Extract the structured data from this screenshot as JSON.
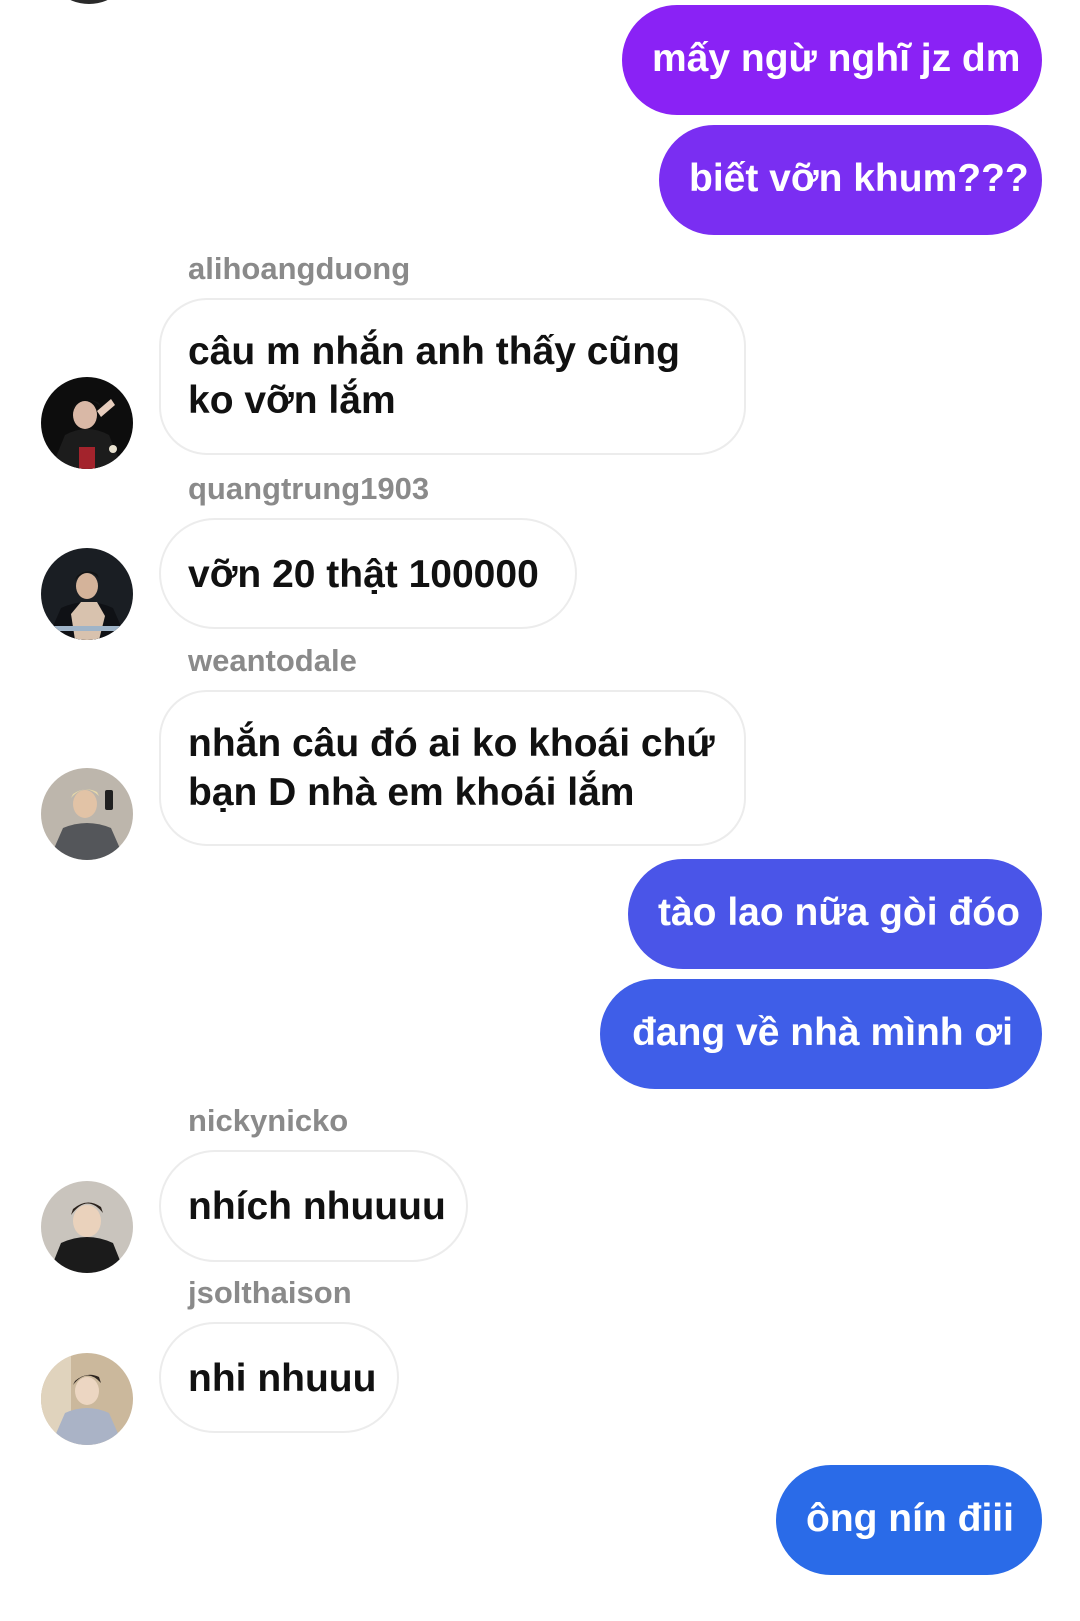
{
  "chat": {
    "colors": {
      "outgoing_purple": "#8a22f5",
      "outgoing_violet": "#7a2ef2",
      "outgoing_indigo": "#4a55e8",
      "outgoing_blue": "#2a6be8",
      "incoming_bg": "#ffffff",
      "sender_name": "#8a8a8a"
    },
    "messages": [
      {
        "direction": "outgoing",
        "text": "mấy ngừ nghĩ jz dm"
      },
      {
        "direction": "outgoing",
        "text": "biết vỡn khum???"
      },
      {
        "direction": "incoming",
        "sender": "alihoangduong",
        "avatar": "alihoangduong-avatar",
        "lines": [
          "câu m nhắn anh thấy cũng",
          "ko vỡn lắm"
        ]
      },
      {
        "direction": "incoming",
        "sender": "quangtrung1903",
        "avatar": "quangtrung1903-avatar",
        "lines": [
          "vỡn 20 thật 100000"
        ]
      },
      {
        "direction": "incoming",
        "sender": "weantodale",
        "avatar": "weantodale-avatar",
        "lines": [
          "nhắn câu đó ai ko khoái chứ",
          "bạn D nhà em khoái lắm"
        ]
      },
      {
        "direction": "outgoing",
        "text": "tào lao nữa gòi đóo"
      },
      {
        "direction": "outgoing",
        "text": "đang về nhà mình ơi"
      },
      {
        "direction": "incoming",
        "sender": "nickynicko",
        "avatar": "nickynicko-avatar",
        "lines": [
          "nhích nhuuuu"
        ]
      },
      {
        "direction": "incoming",
        "sender": "jsolthaison",
        "avatar": "jsolthaison-avatar",
        "lines": [
          "nhi nhuuu"
        ]
      },
      {
        "direction": "outgoing",
        "text": "ông nín điii"
      }
    ]
  }
}
